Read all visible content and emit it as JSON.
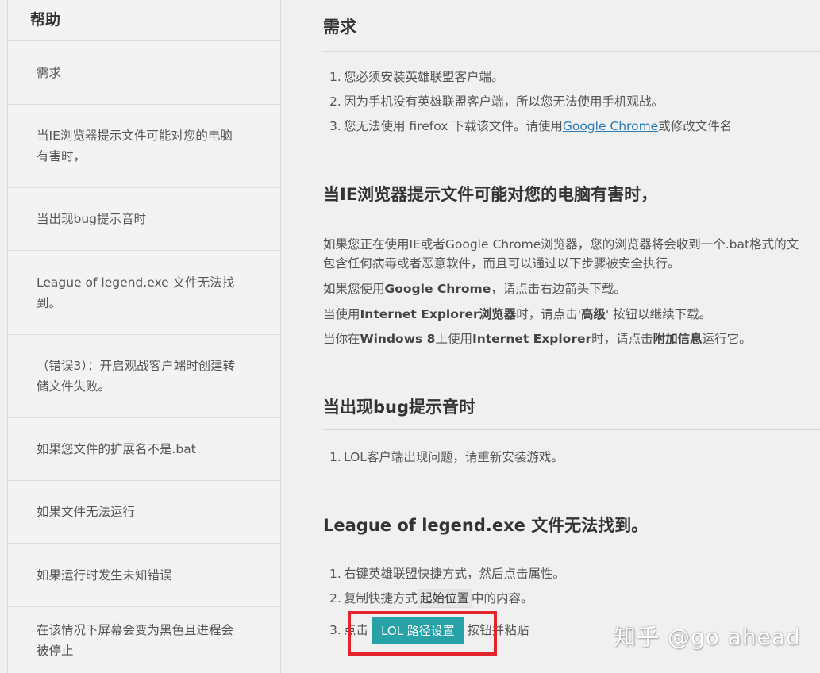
{
  "sidebar": {
    "title": "帮助",
    "items": [
      {
        "lines": [
          "需求"
        ]
      },
      {
        "lines": [
          "当IE浏览器提示文件可能对您的电脑",
          "有害时，"
        ]
      },
      {
        "lines": [
          "当出现bug提示音时"
        ]
      },
      {
        "lines": [
          "League of legend.exe 文件无法找",
          "到。"
        ]
      },
      {
        "lines": [
          "（错误3）：开启观战客户端时创建转",
          "储文件失败。"
        ]
      },
      {
        "lines": [
          "如果您文件的扩展名不是.bat"
        ]
      },
      {
        "lines": [
          "如果文件无法运行"
        ]
      },
      {
        "lines": [
          "如果运行时发生未知错误"
        ]
      },
      {
        "lines": [
          "在该情况下屏幕会变为黑色且进程会",
          "被停止"
        ]
      }
    ]
  },
  "sections": {
    "requirements": {
      "title": "需求",
      "items": [
        {
          "num": "1.",
          "text": "您必须安装英雄联盟客户端。"
        },
        {
          "num": "2.",
          "text": "因为手机没有英雄联盟客户端，所以您无法使用手机观战。"
        },
        {
          "num": "3.",
          "text_before": "您无法使用 firefox 下载该文件。请使用",
          "link": "Google Chrome",
          "text_after": "或修改文件名"
        }
      ]
    },
    "ie_warning": {
      "title": "当IE浏览器提示文件可能对您的电脑有害时，",
      "p1_line1": "如果您正在使用IE或者Google Chrome浏览器，您的浏览器将会收到一个.bat格式的文",
      "p1_line2": "包含任何病毒或者恶意软件，而且可以通过以下步骤被安全执行。",
      "p2_before": "如果您使用",
      "p2_bold": "Google Chrome",
      "p2_after": "，请点击右边箭头下载。",
      "p3_before": "当使用",
      "p3_bold": "Internet Explorer浏览器",
      "p3_mid": "时，请点击'",
      "p3_bold2": "高级",
      "p3_after": "' 按钮以继续下载。",
      "p4_before": "当你在",
      "p4_bold": "Windows 8",
      "p4_mid": "上使用",
      "p4_bold2": "Internet Explorer",
      "p4_mid2": "时，请点击",
      "p4_bold3": "附加信息",
      "p4_after": "运行它。"
    },
    "bug_sound": {
      "title": "当出现bug提示音时",
      "items": [
        {
          "num": "1.",
          "text": "LOL客户端出现问题，请重新安装游戏。"
        }
      ]
    },
    "exe_not_found": {
      "title": "League of legend.exe 文件无法找到。",
      "item1_num": "1.",
      "item1_text": "右键英雄联盟快捷方式，然后点击属性。",
      "item2_num": "2.",
      "item2_before": "复制快捷方式",
      "item2_code": "起始位置",
      "item2_after": "中的内容。",
      "item3_num": "3.",
      "item3_before": "点击",
      "item3_button": "LOL 路径设置",
      "item3_after": "按钮并粘贴"
    }
  },
  "watermark": "知乎 @go ahead",
  "colors": {
    "link": "#2a7bb8",
    "button_bg": "#27a2a6",
    "highlight": "#e2252b"
  }
}
